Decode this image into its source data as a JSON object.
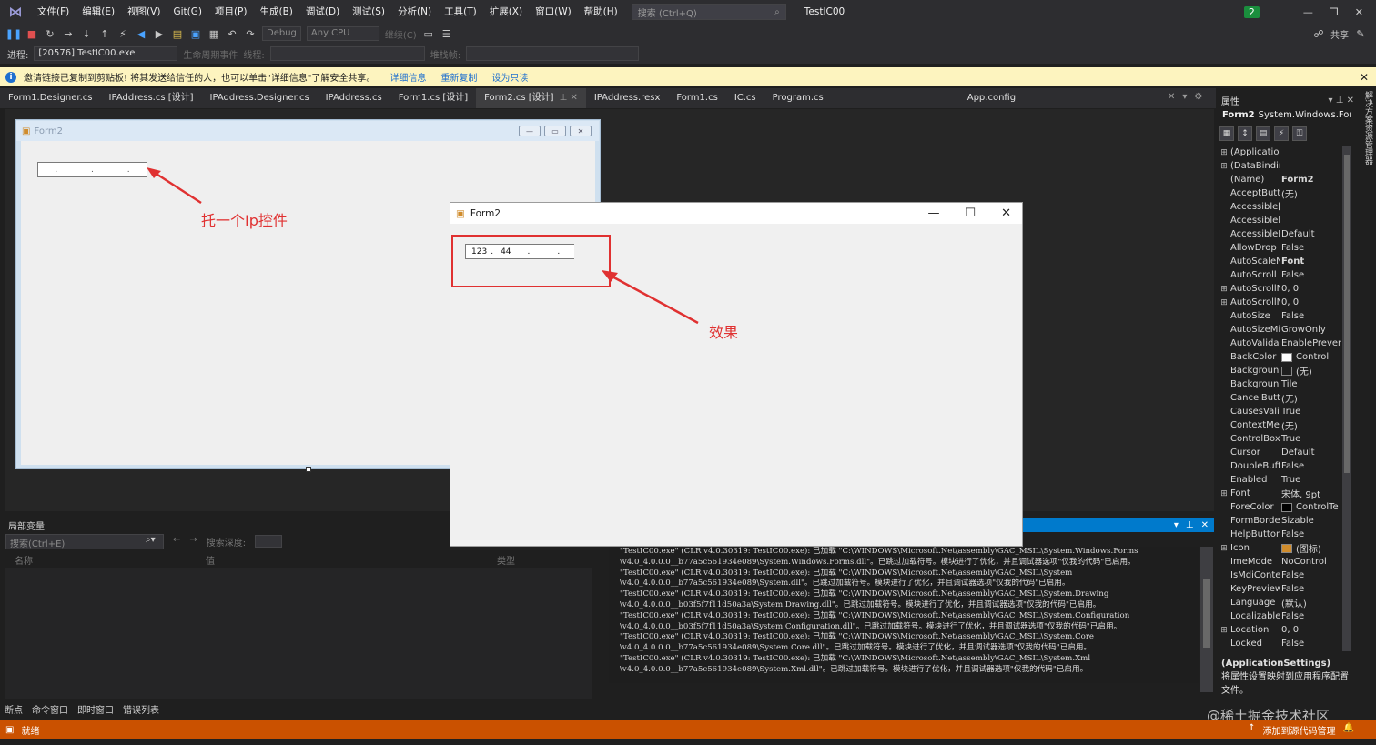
{
  "menubar": {
    "items": [
      "文件(F)",
      "编辑(E)",
      "视图(V)",
      "Git(G)",
      "项目(P)",
      "生成(B)",
      "调试(D)",
      "测试(S)",
      "分析(N)",
      "工具(T)",
      "扩展(X)",
      "窗口(W)",
      "帮助(H)"
    ],
    "search_placeholder": "搜索 (Ctrl+Q)",
    "project_name": "TestIC00",
    "badge": "2",
    "share_label": "共享"
  },
  "toolbar2": {
    "config": "Debug",
    "platform": "Any CPU",
    "continue_label": "继续(C)",
    "process_label": "进程:",
    "process_value": "[20576] TestIC00.exe",
    "lifecycle_label": "生命周期事件",
    "thread_label": "线程:",
    "stackframe_label": "堆栈帧:"
  },
  "infobar": {
    "message": "邀请链接已复制到剪贴板! 将其发送给信任的人，也可以单击\"详细信息\"了解安全共享。",
    "links": [
      "详细信息",
      "重新复制",
      "设为只读"
    ]
  },
  "tabs": [
    {
      "label": "Form1.Designer.cs"
    },
    {
      "label": "IPAddress.cs [设计]"
    },
    {
      "label": "IPAddress.Designer.cs"
    },
    {
      "label": "IPAddress.cs"
    },
    {
      "label": "Form1.cs [设计]"
    },
    {
      "label": "Form2.cs [设计]"
    },
    {
      "label": "IPAddress.resx"
    },
    {
      "label": "Form1.cs"
    },
    {
      "label": "IC.cs"
    },
    {
      "label": "Program.cs"
    },
    {
      "label": "App.config"
    }
  ],
  "designer": {
    "form_title": "Form2",
    "annotation": "托一个Ip控件"
  },
  "runtime": {
    "title": "Form2",
    "ip_octets": [
      "123",
      "44",
      "",
      ""
    ],
    "annotation": "效果"
  },
  "locals": {
    "title": "局部变量",
    "search_placeholder": "搜索(Ctrl+E)",
    "depth_label": "搜索深度:",
    "col_name": "名称",
    "col_value": "值",
    "col_type": "类型"
  },
  "output": {
    "lines": [
      "\"TestIC00.exe\" (CLR v4.0.30319: TestIC00.exe): 已加载 \"C:\\WINDOWS\\Microsoft.Net\\assembly\\GAC_MSIL\\System.Windows.Forms",
      "  \\v4.0_4.0.0.0__b77a5c561934e089\\System.Windows.Forms.dll\"。已跳过加载符号。模块进行了优化，并且调试器选项\"仅我的代码\"已启用。",
      "\"TestIC00.exe\" (CLR v4.0.30319: TestIC00.exe): 已加载 \"C:\\WINDOWS\\Microsoft.Net\\assembly\\GAC_MSIL\\System",
      "  \\v4.0_4.0.0.0__b77a5c561934e089\\System.dll\"。已跳过加载符号。模块进行了优化，并且调试器选项\"仅我的代码\"已启用。",
      "\"TestIC00.exe\" (CLR v4.0.30319: TestIC00.exe): 已加载 \"C:\\WINDOWS\\Microsoft.Net\\assembly\\GAC_MSIL\\System.Drawing",
      "  \\v4.0_4.0.0.0__b03f5f7f11d50a3a\\System.Drawing.dll\"。已跳过加载符号。模块进行了优化，并且调试器选项\"仅我的代码\"已启用。",
      "\"TestIC00.exe\" (CLR v4.0.30319: TestIC00.exe): 已加载 \"C:\\WINDOWS\\Microsoft.Net\\assembly\\GAC_MSIL\\System.Configuration",
      "  \\v4.0_4.0.0.0__b03f5f7f11d50a3a\\System.Configuration.dll\"。已跳过加载符号。模块进行了优化，并且调试器选项\"仅我的代码\"已启用。",
      "\"TestIC00.exe\" (CLR v4.0.30319: TestIC00.exe): 已加载 \"C:\\WINDOWS\\Microsoft.Net\\assembly\\GAC_MSIL\\System.Core",
      "  \\v4.0_4.0.0.0__b77a5c561934e089\\System.Core.dll\"。已跳过加载符号。模块进行了优化，并且调试器选项\"仅我的代码\"已启用。",
      "\"TestIC00.exe\" (CLR v4.0.30319: TestIC00.exe): 已加载 \"C:\\WINDOWS\\Microsoft.Net\\assembly\\GAC_MSIL\\System.Xml",
      "  \\v4.0_4.0.0.0__b77a5c561934e089\\System.Xml.dll\"。已跳过加载符号。模块进行了优化，并且调试器选项\"仅我的代码\"已启用。"
    ]
  },
  "bottom_tabs": [
    "断点",
    "命令窗口",
    "即时窗口",
    "错误列表"
  ],
  "statusbar": {
    "left": "就绪",
    "right": "添加到源代码管理"
  },
  "watermark": "@稀土掘金技术社区",
  "properties": {
    "header": "属性",
    "object_name": "Form2",
    "object_type": "System.Windows.Forn",
    "rows": [
      {
        "name": "(Applicatio",
        "value": "",
        "expand": "⊞"
      },
      {
        "name": "(DataBindir",
        "value": "",
        "expand": "⊞"
      },
      {
        "name": "(Name)",
        "value": "Form2",
        "bold": true
      },
      {
        "name": "AcceptButt",
        "value": "(无)"
      },
      {
        "name": "Accessible[",
        "value": ""
      },
      {
        "name": "AccessibleN",
        "value": ""
      },
      {
        "name": "AccessibleF",
        "value": "Default"
      },
      {
        "name": "AllowDrop",
        "value": "False"
      },
      {
        "name": "AutoScaleN",
        "value": "Font",
        "bold": true
      },
      {
        "name": "AutoScroll",
        "value": "False"
      },
      {
        "name": "AutoScrollN",
        "value": "0, 0",
        "expand": "⊞"
      },
      {
        "name": "AutoScrollN",
        "value": "0, 0",
        "expand": "⊞"
      },
      {
        "name": "AutoSize",
        "value": "False"
      },
      {
        "name": "AutoSizeMi",
        "value": "GrowOnly"
      },
      {
        "name": "AutoValida",
        "value": "EnablePrevent"
      },
      {
        "name": "BackColor",
        "value": "Control",
        "swatch": "#ffffff"
      },
      {
        "name": "Backgroun",
        "value": "(无)",
        "swatch": "#1e1e1e"
      },
      {
        "name": "Backgroun",
        "value": "Tile"
      },
      {
        "name": "CancelButt",
        "value": "(无)"
      },
      {
        "name": "CausesVali",
        "value": "True"
      },
      {
        "name": "ContextMe",
        "value": "(无)"
      },
      {
        "name": "ControlBox",
        "value": "True"
      },
      {
        "name": "Cursor",
        "value": "Default"
      },
      {
        "name": "DoubleBuff",
        "value": "False"
      },
      {
        "name": "Enabled",
        "value": "True"
      },
      {
        "name": "Font",
        "value": "宋体, 9pt",
        "expand": "⊞"
      },
      {
        "name": "ForeColor",
        "value": "ControlTe",
        "swatch": "#000000"
      },
      {
        "name": "FormBorde",
        "value": "Sizable"
      },
      {
        "name": "HelpButton",
        "value": "False"
      },
      {
        "name": "Icon",
        "value": "(图标)",
        "expand": "⊞",
        "swatch": "#d08c2c"
      },
      {
        "name": "ImeMode",
        "value": "NoControl"
      },
      {
        "name": "IsMdiConte",
        "value": "False"
      },
      {
        "name": "KeyPreview",
        "value": "False"
      },
      {
        "name": "Language",
        "value": "(默认)"
      },
      {
        "name": "Localizable",
        "value": "False"
      },
      {
        "name": "Location",
        "value": "0, 0",
        "expand": "⊞"
      },
      {
        "name": "Locked",
        "value": "False"
      }
    ],
    "desc_title": "(ApplicationSettings)",
    "desc_text": "将属性设置映射到应用程序配置文件。"
  },
  "side_tab": "解决方案资源管理器",
  "colors": {
    "accent": "#007acc",
    "status": "#ca5100",
    "annotation": "#e03131"
  }
}
